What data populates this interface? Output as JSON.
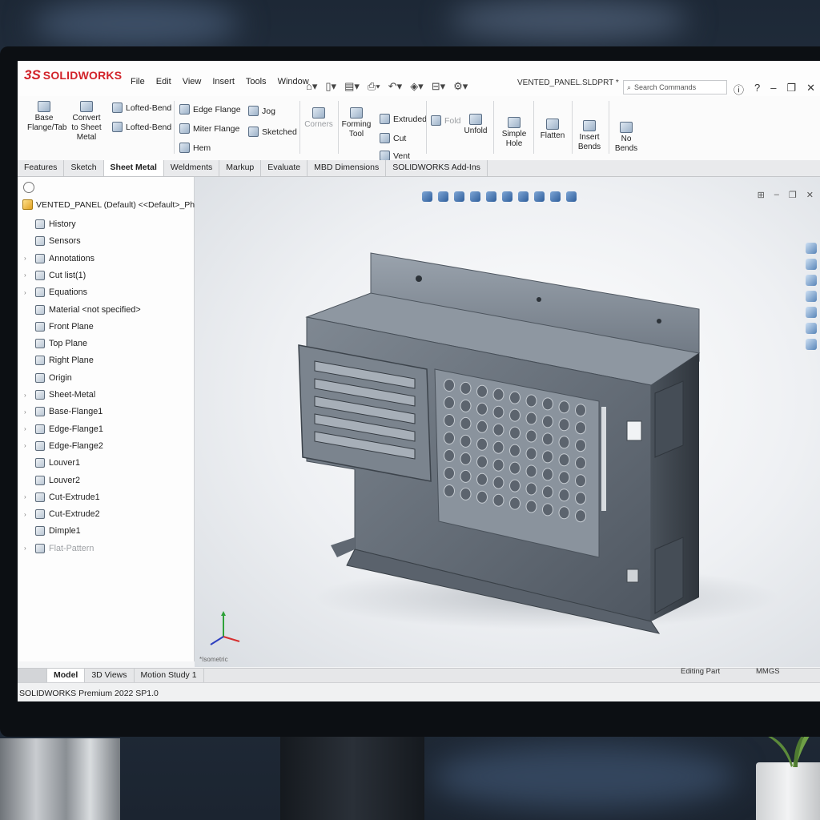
{
  "app": {
    "brand_mark": "3S",
    "brand_name": "SOLIDWORKS"
  },
  "menu": [
    "File",
    "Edit",
    "View",
    "Insert",
    "Tools",
    "Window"
  ],
  "document_title": "VENTED_PANEL.SLDPRT *",
  "search": {
    "placeholder": "Search Commands"
  },
  "command_manager": {
    "base_flange": "Base Flange/Tab",
    "convert": "Convert to Sheet Metal",
    "lofted_bend_1": "Lofted-Bend",
    "lofted_bend_2": "Lofted-Bend",
    "edge_flange": "Edge Flange",
    "miter_flange": "Miter Flange",
    "hem": "Hem",
    "jog": "Jog",
    "sketched": "Sketched",
    "corners": "Corners",
    "forming_tool": "Forming Tool",
    "extruded": "Extruded",
    "cut": "Cut",
    "vent": "Vent",
    "unfold": "Unfold",
    "simple_hole": "Simple Hole",
    "flatten": "Flatten",
    "insert_bends": "Insert Bends",
    "no_bends": "No Bends",
    "fold": "Fold"
  },
  "tabs": [
    "Features",
    "Sketch",
    "Sheet Metal",
    "Weldments",
    "Markup",
    "Evaluate",
    "MBD Dimensions",
    "SOLIDWORKS Add-Ins"
  ],
  "active_tab": "Sheet Metal",
  "tree": {
    "root": "VENTED_PANEL  (Default)  <<Default>_PhotoW",
    "items": [
      {
        "label": "History",
        "expandable": false
      },
      {
        "label": "Sensors",
        "expandable": false
      },
      {
        "label": "Annotations",
        "expandable": true
      },
      {
        "label": "Cut list(1)",
        "expandable": true
      },
      {
        "label": "Equations",
        "expandable": true
      },
      {
        "label": "Material <not specified>",
        "expandable": false
      },
      {
        "label": "Front Plane",
        "expandable": false
      },
      {
        "label": "Top Plane",
        "expandable": false
      },
      {
        "label": "Right Plane",
        "expandable": false
      },
      {
        "label": "Origin",
        "expandable": false
      },
      {
        "label": "Sheet-Metal",
        "expandable": true
      },
      {
        "label": "Base-Flange1",
        "expandable": true
      },
      {
        "label": "Edge-Flange1",
        "expandable": true
      },
      {
        "label": "Edge-Flange2",
        "expandable": true
      },
      {
        "label": "Louver1",
        "expandable": false
      },
      {
        "label": "Louver2",
        "expandable": false
      },
      {
        "label": "Cut-Extrude1",
        "expandable": true
      },
      {
        "label": "Cut-Extrude2",
        "expandable": true
      },
      {
        "label": "Dimple1",
        "expandable": false
      },
      {
        "label": "Flat-Pattern",
        "expandable": true,
        "greyed": true
      }
    ]
  },
  "viewport": {
    "triad_label": "*Isometric"
  },
  "bottom_tabs": [
    "Model",
    "3D Views",
    "Motion Study 1"
  ],
  "status": {
    "version": "SOLIDWORKS Premium 2022 SP1.0",
    "mode": "Editing Part",
    "units": "MMGS"
  },
  "colors": {
    "brand_red": "#d2232a",
    "model_steel": "#6b7480"
  }
}
